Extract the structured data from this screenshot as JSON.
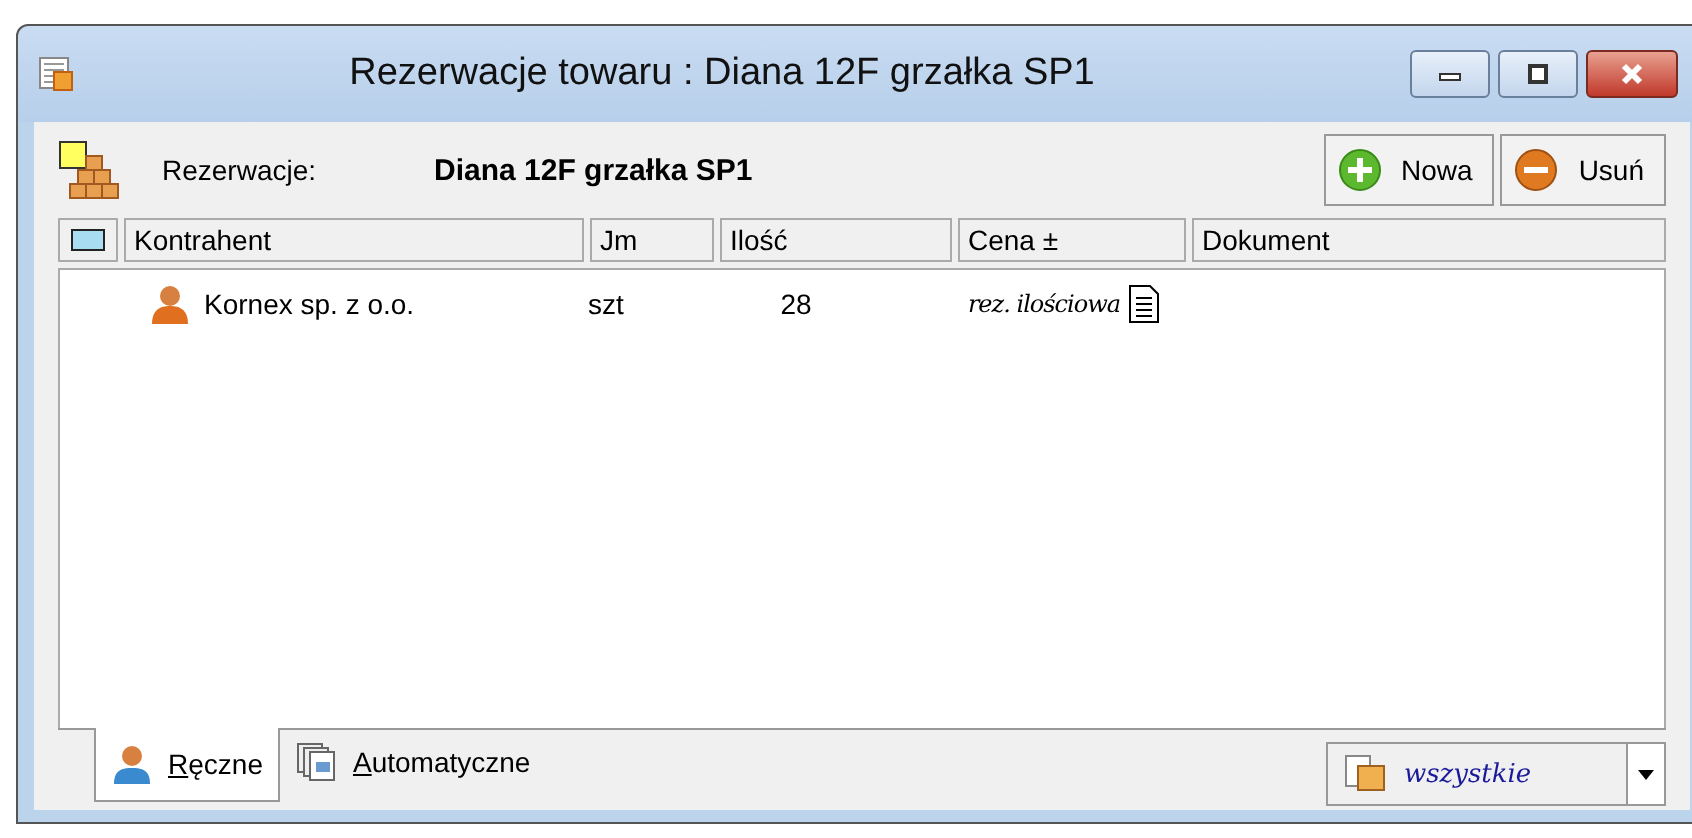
{
  "window": {
    "title": "Rezerwacje towaru : Diana 12F grzałka SP1"
  },
  "header": {
    "label": "Rezerwacje:",
    "value": "Diana 12F grzałka SP1"
  },
  "buttons": [
    {
      "label": "Nowa",
      "kind": "add"
    },
    {
      "label": "Usuń",
      "kind": "remove"
    }
  ],
  "table": {
    "columns": [
      "Kontrahent",
      "Jm",
      "Ilość",
      "Cena ±",
      "Dokument"
    ],
    "rows": [
      {
        "kontrahent": "Kornex sp. z o.o.",
        "jm": "szt",
        "ilosc": "28",
        "cena": "rez. ilościowa"
      }
    ]
  },
  "tabs": [
    {
      "label": "Ręczne",
      "selected": true,
      "kind": "person"
    },
    {
      "label": "Automatyczne",
      "selected": false,
      "kind": "windows"
    }
  ],
  "filter": {
    "value": "wszystkie"
  }
}
